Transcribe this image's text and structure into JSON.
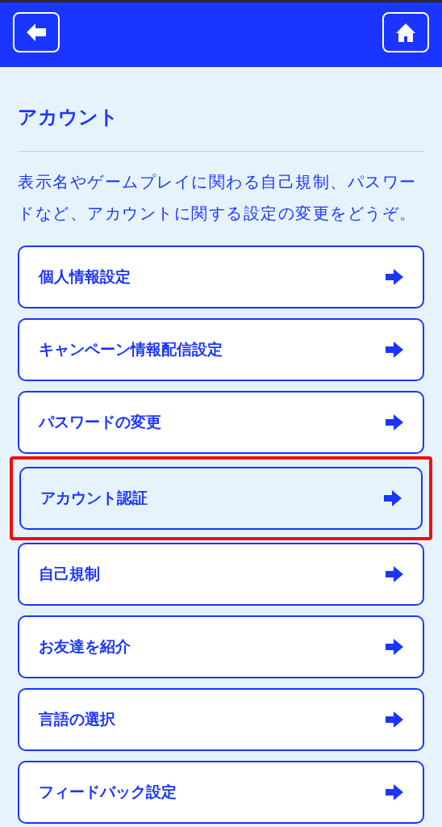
{
  "title": "アカウント",
  "description": "表示名やゲームプレイに関わる自己規制、パスワードなど、アカウントに関する設定の変更をどうぞ。",
  "menu_items": [
    {
      "label": "個人情報設定",
      "selected": false
    },
    {
      "label": "キャンペーン情報配信設定",
      "selected": false
    },
    {
      "label": "パスワードの変更",
      "selected": false
    },
    {
      "label": "アカウント認証",
      "selected": true
    },
    {
      "label": "自己規制",
      "selected": false
    },
    {
      "label": "お友達を紹介",
      "selected": false
    },
    {
      "label": "言語の選択",
      "selected": false
    },
    {
      "label": "フィードバック設定",
      "selected": false
    }
  ]
}
